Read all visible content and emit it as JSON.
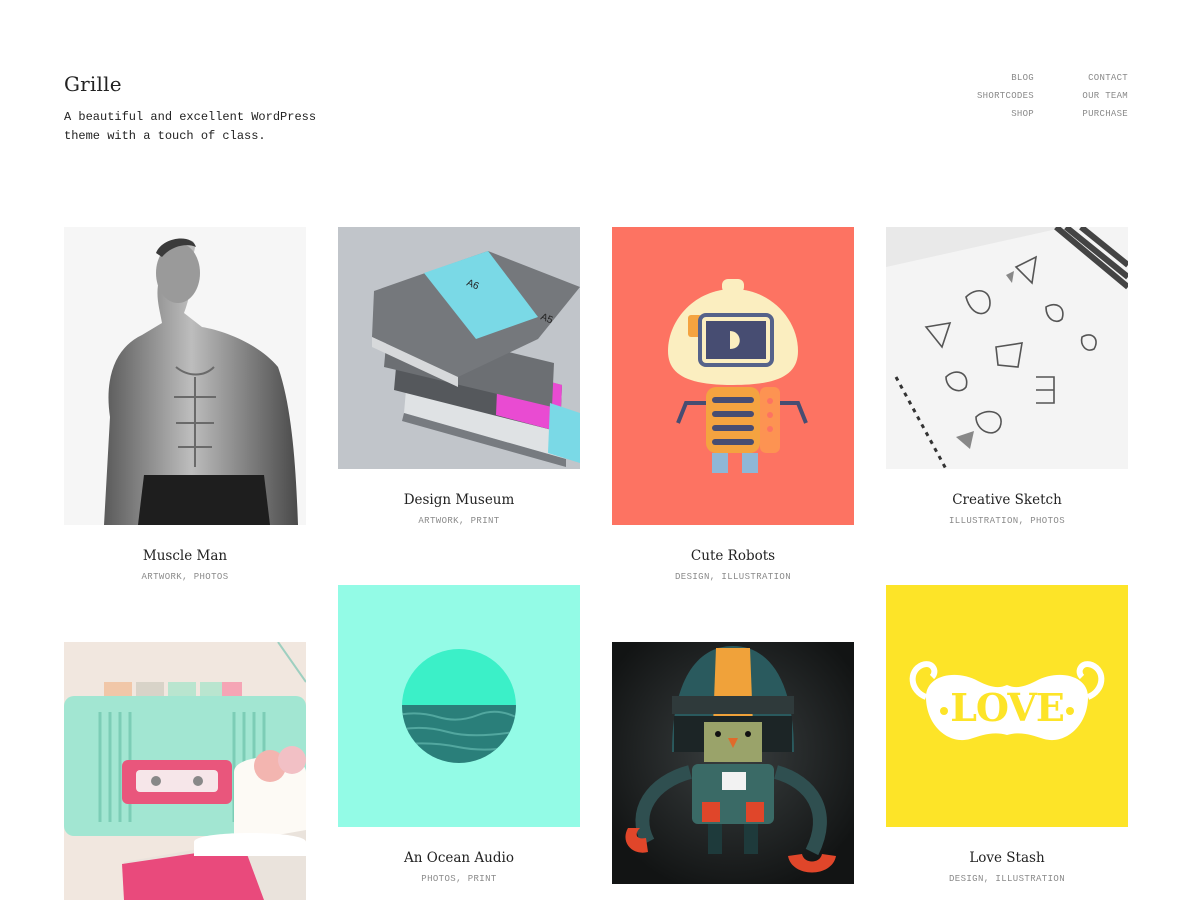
{
  "site": {
    "title": "Grille",
    "tagline": "A beautiful and excellent WordPress theme with a touch of class."
  },
  "nav": {
    "blog": "BLOG",
    "shortcodes": "SHORTCODES",
    "shop": "SHOP",
    "contact": "CONTACT",
    "our_team": "OUR TEAM",
    "purchase": "PURCHASE"
  },
  "portfolio": [
    {
      "title": "Muscle Man",
      "cats": [
        "ARTWORK",
        "PHOTOS"
      ],
      "image": "black-and-white photo of shirtless man"
    },
    {
      "title": "Design Museum",
      "cats": [
        "ARTWORK",
        "PRINT"
      ],
      "image": "stack of grey notebooks with cyan and pink bands"
    },
    {
      "title": "Cute Robots",
      "cats": [
        "DESIGN",
        "ILLUSTRATION"
      ],
      "image": "cream robot on coral background"
    },
    {
      "title": "Creative Sketch",
      "cats": [
        "ILLUSTRATION",
        "PHOTOS"
      ],
      "image": "logo sketches on spiral notebook"
    },
    {
      "title": "",
      "cats": [],
      "image": "mint radio cassette player with macarons"
    },
    {
      "title": "An Ocean Audio",
      "cats": [
        "PHOTOS",
        "PRINT"
      ],
      "image": "ocean circle on aqua background"
    },
    {
      "title": "",
      "cats": [],
      "image": "helmeted robot on dark background"
    },
    {
      "title": "Love Stash",
      "cats": [
        "DESIGN",
        "ILLUSTRATION"
      ],
      "image": "LOVE moustache lettering on yellow"
    }
  ],
  "cat_separator": ", ",
  "colors": {
    "coral": "#fd7362",
    "aqua": "#93fbe6",
    "yellow": "#fde428",
    "text_muted": "#8a8a8a"
  }
}
